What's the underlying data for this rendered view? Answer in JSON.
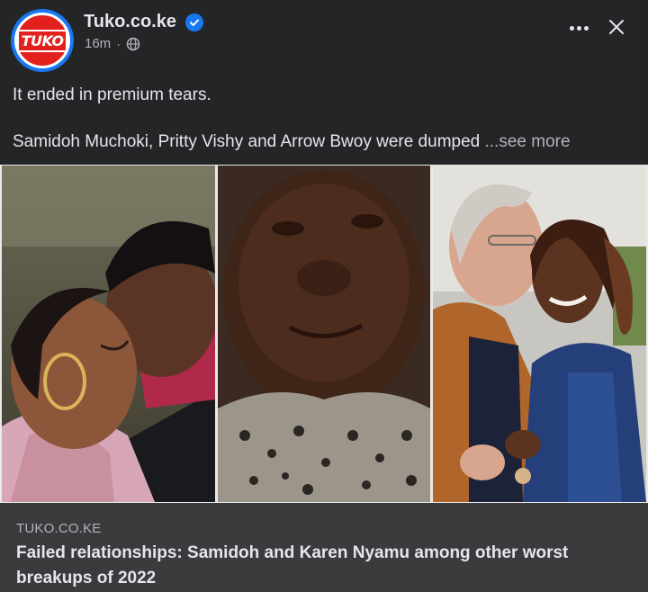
{
  "post": {
    "page_name": "Tuko.co.ke",
    "avatar_text": "TUKO",
    "time": "16m",
    "separator": "·",
    "audience_icon": "globe-icon",
    "verified_icon": "verified-badge-icon",
    "text_line1": "It ended in premium tears.",
    "text_line2": "Samidoh Muchoki, Pritty Vishy and Arrow Bwoy were dumped ",
    "see_more": "...see more"
  },
  "header_actions": {
    "more_icon": "more-dots-icon",
    "close_icon": "close-icon"
  },
  "images": [
    {
      "name": "photo-couple-embracing",
      "icon": "photo"
    },
    {
      "name": "photo-woman-crying",
      "icon": "photo"
    },
    {
      "name": "photo-couple-kissing",
      "icon": "photo"
    }
  ],
  "link_preview": {
    "source": "TUKO.CO.KE",
    "title": "Failed relationships: Samidoh and Karen Nyamu among other worst breakups of 2022"
  },
  "colors": {
    "background": "#242526",
    "link_box": "#3a3b3c",
    "brand_red": "#e2211c",
    "facebook_blue": "#1877f2",
    "text_primary": "#e4e6eb",
    "text_secondary": "#b0b3b8"
  }
}
